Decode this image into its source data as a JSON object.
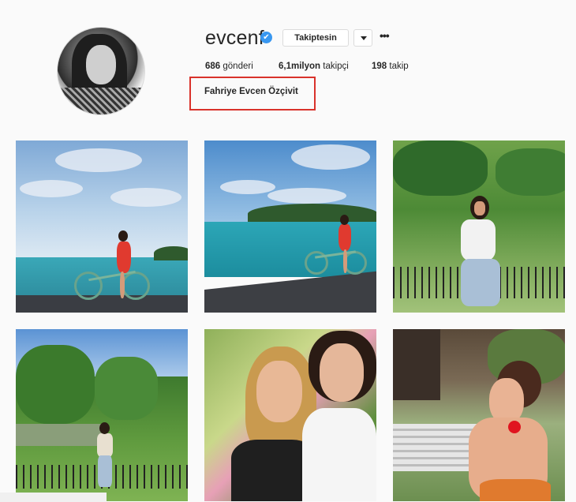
{
  "profile": {
    "username": "evcenf",
    "verified_mark": "✔",
    "follow_label": "Takiptesin",
    "more_label": "•••",
    "stats": {
      "posts_count": "686",
      "posts_label": "gönderi",
      "followers_count": "6,1milyon",
      "followers_label": "takipçi",
      "following_count": "198",
      "following_label": "takip"
    },
    "full_name": "Fahriye Evcen Özçivit"
  },
  "colors": {
    "highlight_box": "#d9322b",
    "verified": "#3897f0"
  },
  "icons": {
    "verified": "verified-badge-icon",
    "dropdown": "chevron-down-icon",
    "more": "more-options-icon"
  },
  "posts": [
    {
      "subject": "post-1"
    },
    {
      "subject": "post-2"
    },
    {
      "subject": "post-3"
    },
    {
      "subject": "post-4"
    },
    {
      "subject": "post-5"
    },
    {
      "subject": "post-6"
    }
  ]
}
